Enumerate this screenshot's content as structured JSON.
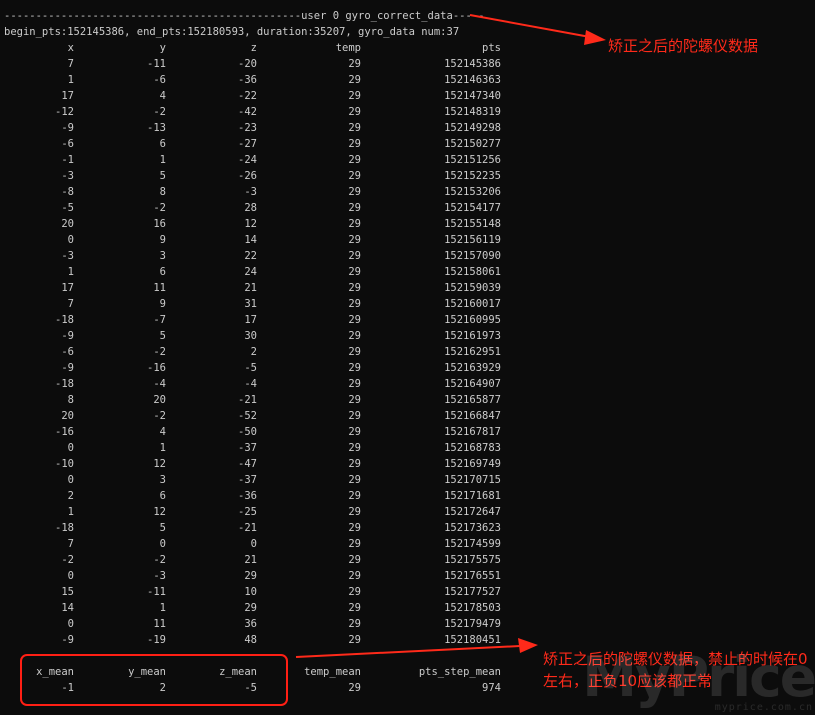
{
  "terminal": {
    "header": "-----------------------------------------------user 0 gyro_correct_data-----",
    "info": "begin_pts:152145386, end_pts:152180593, duration:35207, gyro_data num:37",
    "columns": [
      "x",
      "y",
      "z",
      "temp",
      "pts"
    ],
    "rows": [
      [
        "7",
        "-11",
        "-20",
        "29",
        "152145386"
      ],
      [
        "1",
        "-6",
        "-36",
        "29",
        "152146363"
      ],
      [
        "17",
        "4",
        "-22",
        "29",
        "152147340"
      ],
      [
        "-12",
        "-2",
        "-42",
        "29",
        "152148319"
      ],
      [
        "-9",
        "-13",
        "-23",
        "29",
        "152149298"
      ],
      [
        "-6",
        "6",
        "-27",
        "29",
        "152150277"
      ],
      [
        "-1",
        "1",
        "-24",
        "29",
        "152151256"
      ],
      [
        "-3",
        "5",
        "-26",
        "29",
        "152152235"
      ],
      [
        "-8",
        "8",
        "-3",
        "29",
        "152153206"
      ],
      [
        "-5",
        "-2",
        "28",
        "29",
        "152154177"
      ],
      [
        "20",
        "16",
        "12",
        "29",
        "152155148"
      ],
      [
        "0",
        "9",
        "14",
        "29",
        "152156119"
      ],
      [
        "-3",
        "3",
        "22",
        "29",
        "152157090"
      ],
      [
        "1",
        "6",
        "24",
        "29",
        "152158061"
      ],
      [
        "17",
        "11",
        "21",
        "29",
        "152159039"
      ],
      [
        "7",
        "9",
        "31",
        "29",
        "152160017"
      ],
      [
        "-18",
        "-7",
        "17",
        "29",
        "152160995"
      ],
      [
        "-9",
        "5",
        "30",
        "29",
        "152161973"
      ],
      [
        "-6",
        "-2",
        "2",
        "29",
        "152162951"
      ],
      [
        "-9",
        "-16",
        "-5",
        "29",
        "152163929"
      ],
      [
        "-18",
        "-4",
        "-4",
        "29",
        "152164907"
      ],
      [
        "8",
        "20",
        "-21",
        "29",
        "152165877"
      ],
      [
        "20",
        "-2",
        "-52",
        "29",
        "152166847"
      ],
      [
        "-16",
        "4",
        "-50",
        "29",
        "152167817"
      ],
      [
        "0",
        "1",
        "-37",
        "29",
        "152168783"
      ],
      [
        "-10",
        "12",
        "-47",
        "29",
        "152169749"
      ],
      [
        "0",
        "3",
        "-37",
        "29",
        "152170715"
      ],
      [
        "2",
        "6",
        "-36",
        "29",
        "152171681"
      ],
      [
        "1",
        "12",
        "-25",
        "29",
        "152172647"
      ],
      [
        "-18",
        "5",
        "-21",
        "29",
        "152173623"
      ],
      [
        "7",
        "0",
        "0",
        "29",
        "152174599"
      ],
      [
        "-2",
        "-2",
        "21",
        "29",
        "152175575"
      ],
      [
        "0",
        "-3",
        "29",
        "29",
        "152176551"
      ],
      [
        "15",
        "-11",
        "10",
        "29",
        "152177527"
      ],
      [
        "14",
        "1",
        "29",
        "29",
        "152178503"
      ],
      [
        "0",
        "11",
        "36",
        "29",
        "152179479"
      ],
      [
        "-9",
        "-19",
        "48",
        "29",
        "152180451"
      ]
    ],
    "mean_columns": [
      "x_mean",
      "y_mean",
      "z_mean",
      "temp_mean",
      "pts_step_mean"
    ],
    "mean_values": [
      "-1",
      "2",
      "-5",
      "29",
      "974"
    ]
  },
  "annotations": {
    "top": "矫正之后的陀螺仪数据",
    "bottom": "矫正之后的陀螺仪数据，禁止的时候在0左右，正负10应该都正常",
    "color": "#ff2a1a"
  },
  "watermark": {
    "large": "MyPrice",
    "small": "myprice.com.cn"
  }
}
